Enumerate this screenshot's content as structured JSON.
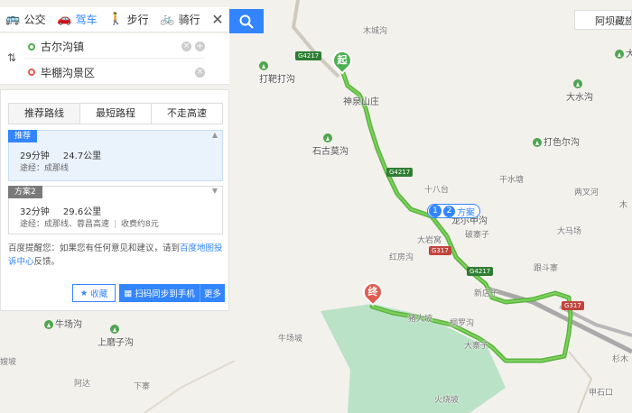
{
  "modes": [
    {
      "label": "公交",
      "icon": "bus-icon"
    },
    {
      "label": "驾车",
      "icon": "car-icon"
    },
    {
      "label": "步行",
      "icon": "walk-icon"
    },
    {
      "label": "骑行",
      "icon": "bike-icon"
    }
  ],
  "inputs": {
    "start": "古尔沟镇",
    "end": "毕棚沟景区"
  },
  "result_tabs": [
    "推荐路线",
    "最短路程",
    "不走高速"
  ],
  "plans": [
    {
      "tag": "推荐",
      "time": "29分钟",
      "distance": "24.7公里",
      "via": "途经：成那线",
      "toll": ""
    },
    {
      "tag": "方案2",
      "time": "32分钟",
      "distance": "29.6公里",
      "via": "途经：成那线、蓉昌高速",
      "toll": "收费约8元"
    }
  ],
  "tip": {
    "prefix": "百度提醒您：如果您有任何意见和建议，请到",
    "link": "百度地图投诉中心",
    "suffix": "反馈。"
  },
  "buttons": {
    "favorite": "收藏",
    "scan": "扫码同步到手机",
    "more": "更多"
  },
  "map": {
    "top_right": "阿坝藏族羌",
    "route_tag_num1": "1",
    "route_tag_num2": "2",
    "route_tag_text": "方案",
    "start_pin": "起",
    "end_pin": "终",
    "road_badges": [
      "G4217",
      "G4217",
      "G317",
      "G4217",
      "G317"
    ],
    "places": [
      "木城沟",
      "打靶打沟",
      "神泉山庄",
      "石古莫沟",
      "打色尔沟",
      "大水沟",
      "大水",
      "干水塘",
      "十八台",
      "龙尔甲沟",
      "两叉河",
      "破寨子",
      "大岩窝",
      "大马场",
      "红房沟",
      "跟斗寨",
      "新店子",
      "牛场沟",
      "上磨子沟",
      "牛场坡",
      "嫂坡",
      "猪大坡",
      "桐罗沟",
      "阿达",
      "下寨",
      "火烧坡",
      "甲石口",
      "杉木",
      "大寨子",
      "木"
    ],
    "colors": {
      "route": "#5bb43f",
      "accent": "#3385ff",
      "park": "#b9e2c7"
    }
  }
}
